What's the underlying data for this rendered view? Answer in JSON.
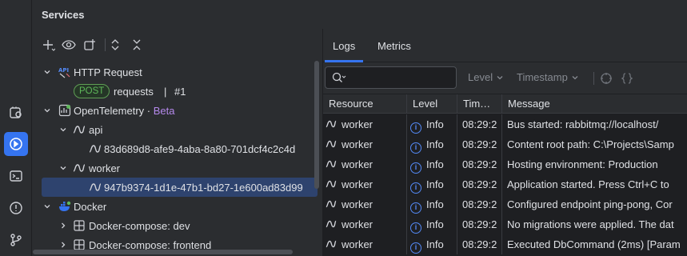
{
  "services": {
    "title": "Services"
  },
  "tree": {
    "http_request": {
      "label": "HTTP Request",
      "method": "POST",
      "target": "requests",
      "separator": "|",
      "number": "#1"
    },
    "opentelemetry": {
      "label": "OpenTelemetry",
      "dot": "·",
      "beta": "Beta"
    },
    "api": {
      "label": "api",
      "trace_id": "83d689d8-afe9-4aba-8a80-701dcf4c2c4d"
    },
    "worker": {
      "label": "worker",
      "trace_id": "947b9374-1d1e-47b1-bd27-1e600ad83d99"
    },
    "docker": {
      "label": "Docker"
    },
    "compose_dev": {
      "label": "Docker-compose: dev"
    },
    "compose_frontend": {
      "label": "Docker-compose: frontend"
    }
  },
  "tabs": [
    {
      "label": "Logs"
    },
    {
      "label": "Metrics"
    }
  ],
  "filters": {
    "level": "Level",
    "timestamp": "Timestamp"
  },
  "log_table": {
    "columns": [
      "Resource",
      "Level",
      "Tim…",
      "Message"
    ],
    "rows": [
      {
        "resource": "worker",
        "level": "Info",
        "time": "08:29:2",
        "message": "Bus started: rabbitmq://localhost/"
      },
      {
        "resource": "worker",
        "level": "Info",
        "time": "08:29:2",
        "message": "Content root path: C:\\Projects\\Samp"
      },
      {
        "resource": "worker",
        "level": "Info",
        "time": "08:29:2",
        "message": "Hosting environment: Production"
      },
      {
        "resource": "worker",
        "level": "Info",
        "time": "08:29:2",
        "message": "Application started. Press Ctrl+C to"
      },
      {
        "resource": "worker",
        "level": "Info",
        "time": "08:29:2",
        "message": "Configured endpoint ping-pong, Cor"
      },
      {
        "resource": "worker",
        "level": "Info",
        "time": "08:29:2",
        "message": "No migrations were applied. The dat"
      },
      {
        "resource": "worker",
        "level": "Info",
        "time": "08:29:2",
        "message": "Executed DbCommand (2ms) [Param"
      }
    ]
  },
  "colors": {
    "accent": "#3574f0",
    "beta": "#b589ec",
    "post": "#5fb85a",
    "info": "#548af7"
  }
}
